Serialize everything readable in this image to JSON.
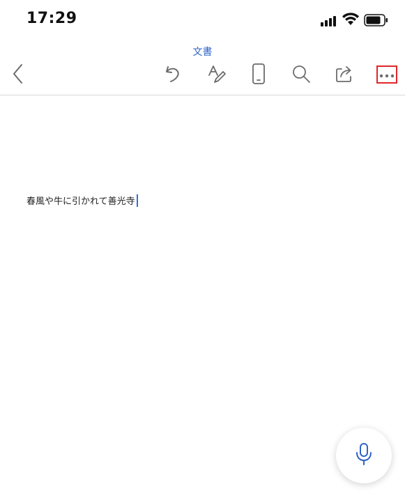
{
  "status_bar": {
    "time": "17:29",
    "icons": [
      "signal-icon",
      "wifi-icon",
      "battery-icon"
    ]
  },
  "toolbar": {
    "title": "文書",
    "buttons": [
      "back-icon",
      "undo-icon",
      "draw-icon",
      "mobile-view-icon",
      "search-icon",
      "share-icon",
      "more-icon"
    ]
  },
  "document": {
    "text": "春風や牛に引かれて善光寺"
  },
  "mic": {
    "icon": "microphone-icon"
  },
  "colors": {
    "accent": "#2f63c9",
    "highlight_box": "#e0262a",
    "icon_gray": "#6b6b6b"
  }
}
